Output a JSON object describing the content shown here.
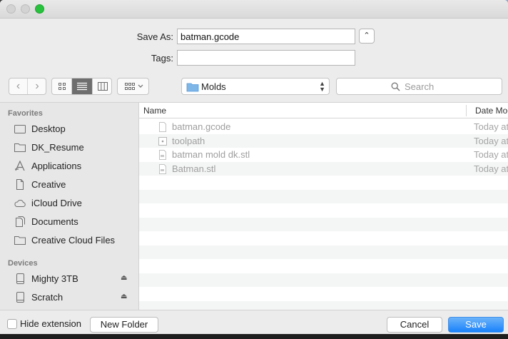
{
  "dialog": {
    "save_as_label": "Save As:",
    "save_as_value": "batman.gcode",
    "tags_label": "Tags:",
    "tags_value": ""
  },
  "toolbar": {
    "location": "Molds",
    "search_placeholder": "Search"
  },
  "sidebar": {
    "favorites_header": "Favorites",
    "favorites": [
      {
        "label": "Desktop",
        "icon": "desktop-icon"
      },
      {
        "label": "DK_Resume",
        "icon": "folder-icon"
      },
      {
        "label": "Applications",
        "icon": "applications-icon"
      },
      {
        "label": "Creative",
        "icon": "document-icon"
      },
      {
        "label": "iCloud Drive",
        "icon": "cloud-icon"
      },
      {
        "label": "Documents",
        "icon": "documents-icon"
      },
      {
        "label": "Creative Cloud Files",
        "icon": "folder-icon"
      }
    ],
    "devices_header": "Devices",
    "devices": [
      {
        "label": "Mighty 3TB",
        "icon": "drive-icon"
      },
      {
        "label": "Scratch",
        "icon": "drive-icon"
      }
    ]
  },
  "filelist": {
    "columns": [
      "Name",
      "Date Modified"
    ],
    "files": [
      {
        "name": "batman.gcode",
        "date": "Today at"
      },
      {
        "name": "toolpath",
        "date": "Today at"
      },
      {
        "name": "batman mold dk.stl",
        "date": "Today at"
      },
      {
        "name": "Batman.stl",
        "date": "Today at"
      }
    ]
  },
  "footer": {
    "hide_extension_label": "Hide extension",
    "new_folder_label": "New Folder",
    "cancel_label": "Cancel",
    "save_label": "Save"
  },
  "colors": {
    "accent": "#1a82fb",
    "sidebar_bg": "#e7e7e7",
    "window_bg": "#ececec"
  }
}
